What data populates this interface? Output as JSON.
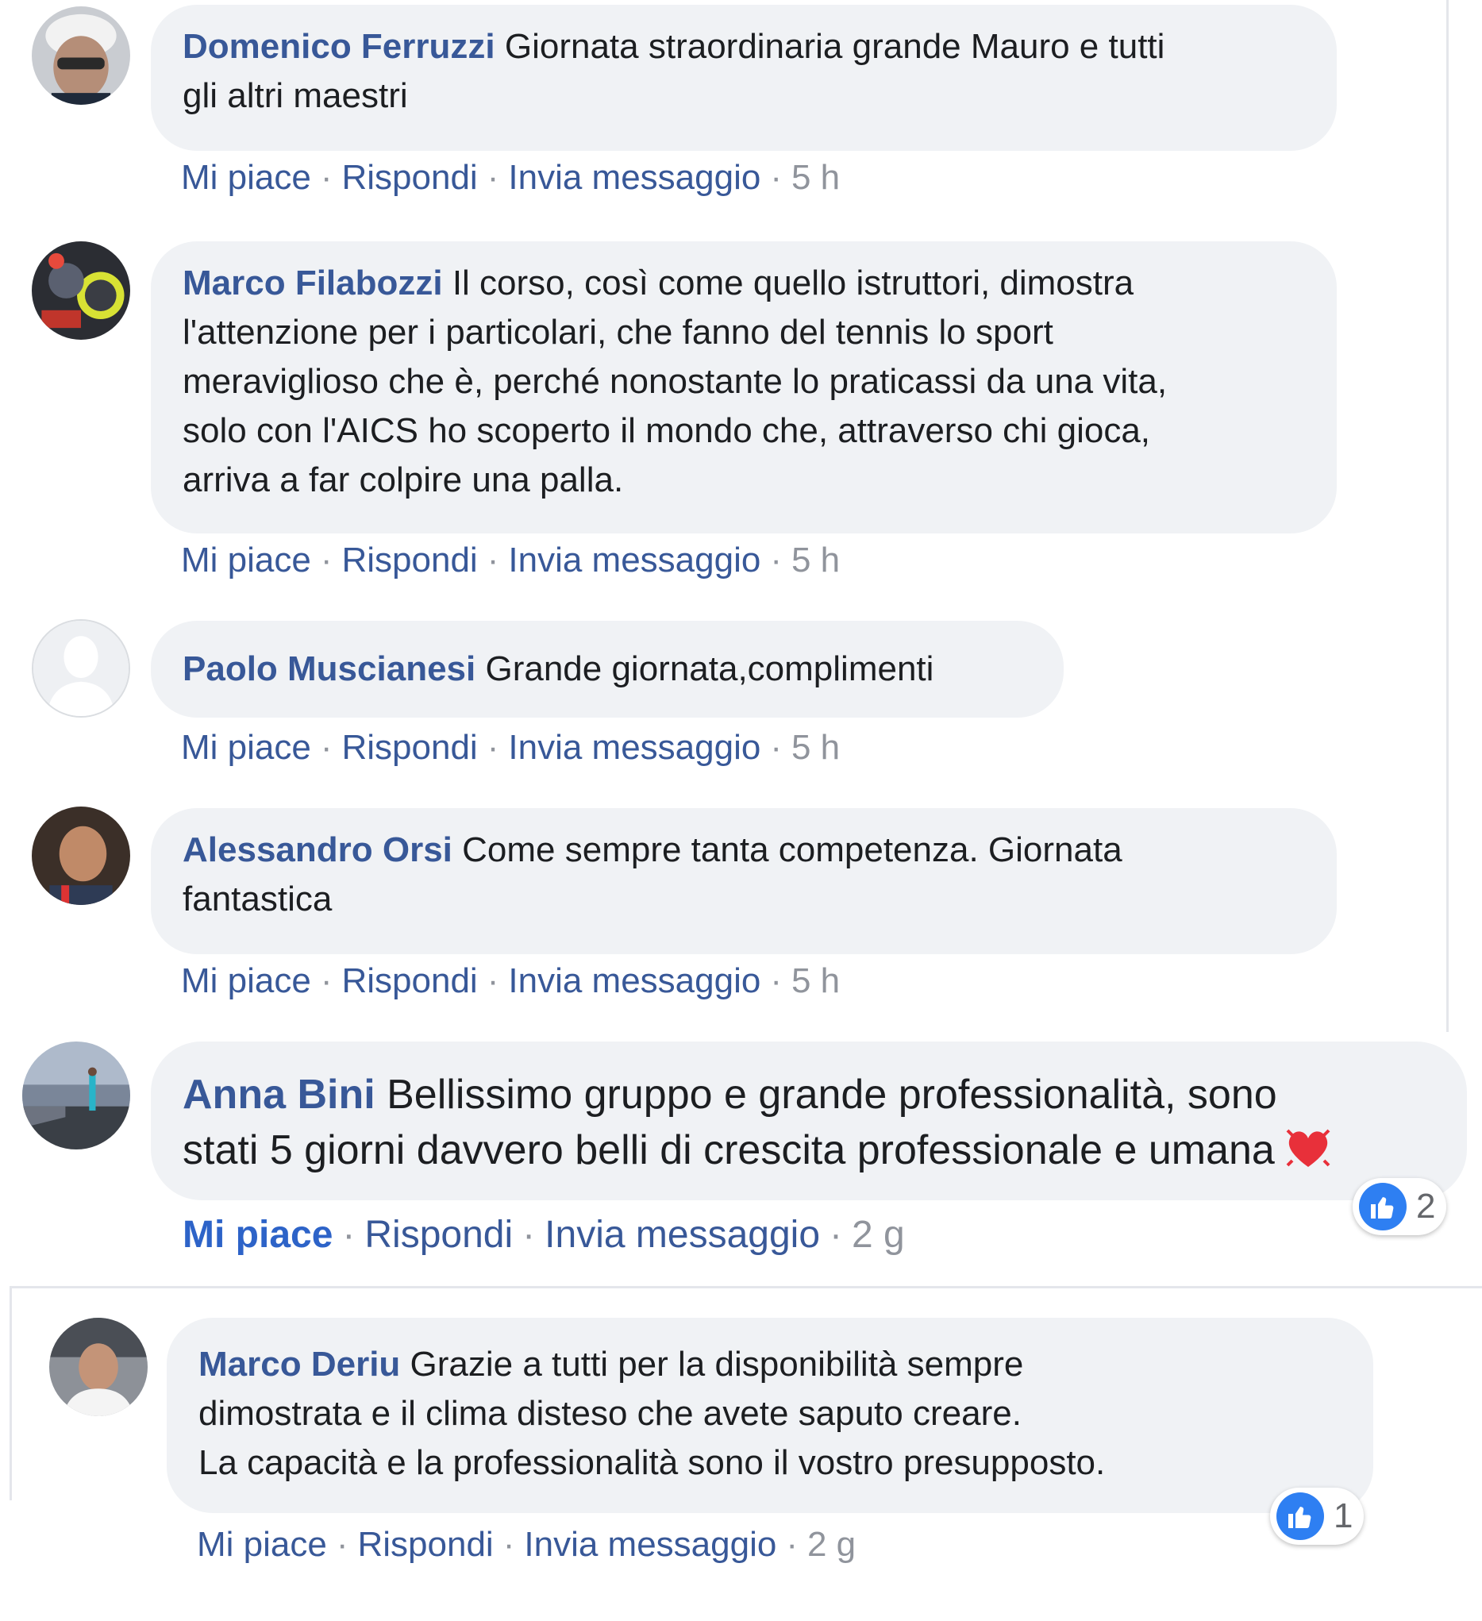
{
  "comments": [
    {
      "author": "Domenico Ferruzzi",
      "text": "Giornata straordinaria grande Mauro e tutti\ngli altri maestri",
      "like": "Mi piace",
      "reply": "Rispondi",
      "message": "Invia messaggio",
      "time": "5 h"
    },
    {
      "author": "Marco Filabozzi",
      "text": "Il corso, così come quello istruttori, dimostra\nl'attenzione per i particolari, che fanno del tennis lo sport\nmeraviglioso che è, perché nonostante lo praticassi da una vita,\nsolo con l'AICS ho scoperto il mondo che, attraverso chi gioca,\narriva a far colpire una palla.",
      "like": "Mi piace",
      "reply": "Rispondi",
      "message": "Invia messaggio",
      "time": "5 h"
    },
    {
      "author": "Paolo Muscianesi",
      "text": "Grande giornata,complimenti",
      "like": "Mi piace",
      "reply": "Rispondi",
      "message": "Invia messaggio",
      "time": "5 h"
    },
    {
      "author": "Alessandro Orsi",
      "text": "Come sempre tanta competenza. Giornata\nfantastica",
      "like": "Mi piace",
      "reply": "Rispondi",
      "message": "Invia messaggio",
      "time": "5 h"
    },
    {
      "author": "Anna Bini",
      "text": "Bellissimo gruppo e grande professionalità, sono\nstati 5 giorni davvero belli di crescita professionale e umana",
      "like": "Mi piace",
      "reply": "Rispondi",
      "message": "Invia messaggio",
      "time": "2 g",
      "reaction_count": "2"
    },
    {
      "author": "Marco Deriu",
      "text": "Grazie a tutti per la disponibilità sempre\ndimostrata e il clima disteso che avete saputo creare.\nLa capacità e la professionalità sono il vostro presupposto.",
      "like": "Mi piace",
      "reply": "Rispondi",
      "message": "Invia messaggio",
      "time": "2 g",
      "reaction_count": "1"
    }
  ],
  "separator": "·",
  "colors": {
    "author": "#385898",
    "bubble": "#f0f2f5",
    "like_badge": "#2e7ff2",
    "meta": "#90949c"
  }
}
